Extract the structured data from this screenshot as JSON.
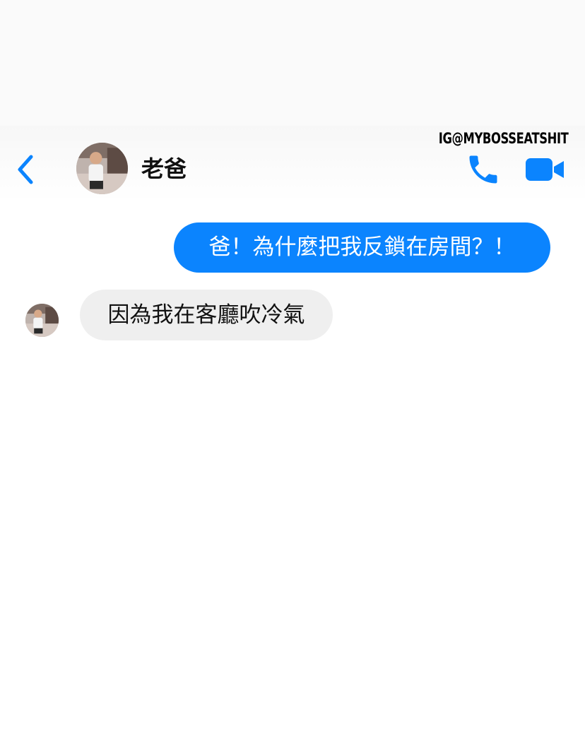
{
  "header": {
    "contact_name": "老爸",
    "watermark": "IG@MYBOSSEATSHIT",
    "back_icon": "chevron-left-icon",
    "call_icon": "phone-icon",
    "video_icon": "video-camera-icon",
    "accent_color": "#0b84fe"
  },
  "messages": [
    {
      "direction": "outgoing",
      "text": "爸！為什麼把我反鎖在房間？！"
    },
    {
      "direction": "incoming",
      "text": "因為我在客廳吹冷氣"
    }
  ]
}
